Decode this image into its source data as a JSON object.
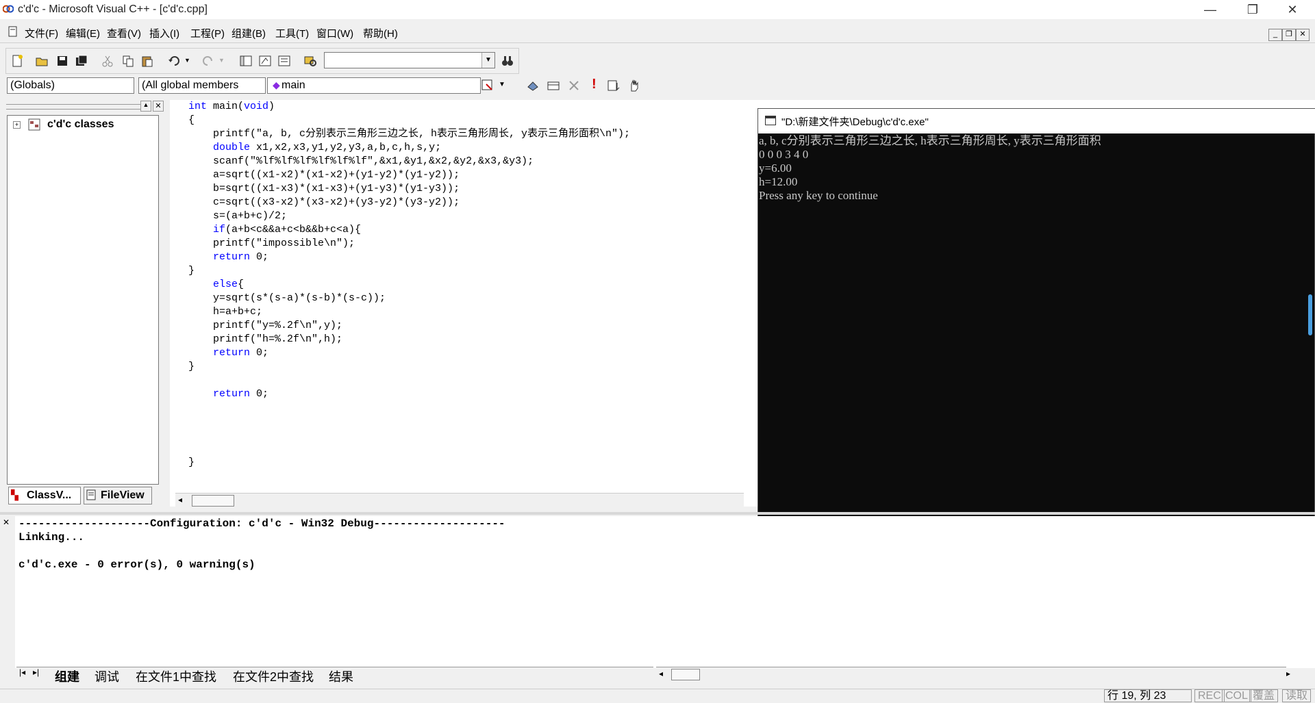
{
  "window": {
    "title": "c'd'c - Microsoft Visual C++ - [c'd'c.cpp]",
    "controls": [
      "—",
      "❐",
      "✕"
    ]
  },
  "menu": [
    "文件(F)",
    "编辑(E)",
    "查看(V)",
    "插入(I)",
    "工程(P)",
    "组建(B)",
    "工具(T)",
    "窗口(W)",
    "帮助(H)"
  ],
  "wizard_bar": {
    "scope": "(Globals)",
    "filter": "(All global members",
    "member": "main"
  },
  "workspace": {
    "tree_root": "c'd'c classes",
    "tabs": [
      "ClassV...",
      "FileView"
    ]
  },
  "editor": {
    "lines": [
      [
        {
          "t": "int",
          "k": true
        },
        {
          "t": " main("
        },
        {
          "t": "void",
          "k": true
        },
        {
          "t": ")"
        }
      ],
      [
        {
          "t": "{"
        }
      ],
      [
        {
          "t": "    printf(\"a, b, c分别表示三角形三边之长, h表示三角形周长, y表示三角形面积\\n\");"
        }
      ],
      [
        {
          "t": "    "
        },
        {
          "t": "double",
          "k": true
        },
        {
          "t": " x1,x2,x3,y1,y2,y3,a,b,c,h,s,y;"
        }
      ],
      [
        {
          "t": "    scanf(\"%lf%lf%lf%lf%lf%lf\",&x1,&y1,&x2,&y2,&x3,&y3);"
        }
      ],
      [
        {
          "t": "    a=sqrt((x1-x2)*(x1-x2)+(y1-y2)*(y1-y2));"
        }
      ],
      [
        {
          "t": "    b=sqrt((x1-x3)*(x1-x3)+(y1-y3)*(y1-y3));"
        }
      ],
      [
        {
          "t": "    c=sqrt((x3-x2)*(x3-x2)+(y3-y2)*(y3-y2));"
        }
      ],
      [
        {
          "t": "    s=(a+b+c)/2;"
        }
      ],
      [
        {
          "t": "    "
        },
        {
          "t": "if",
          "k": true
        },
        {
          "t": "(a+b<c&&a+c<b&&b+c<a){"
        }
      ],
      [
        {
          "t": "    printf(\"impossible\\n\");"
        }
      ],
      [
        {
          "t": "    "
        },
        {
          "t": "return",
          "k": true
        },
        {
          "t": " 0;"
        }
      ],
      [
        {
          "t": "}"
        }
      ],
      [
        {
          "t": "    "
        },
        {
          "t": "else",
          "k": true
        },
        {
          "t": "{"
        }
      ],
      [
        {
          "t": "    y=sqrt(s*(s-a)*(s-b)*(s-c));"
        }
      ],
      [
        {
          "t": "    h=a+b+c;"
        }
      ],
      [
        {
          "t": "    printf(\"y=%.2f\\n\",y);"
        }
      ],
      [
        {
          "t": "    printf(\"h=%.2f\\n\",h);"
        }
      ],
      [
        {
          "t": "    "
        },
        {
          "t": "return",
          "k": true
        },
        {
          "t": " 0;"
        }
      ],
      [
        {
          "t": "}"
        }
      ],
      [
        {
          "t": ""
        }
      ],
      [
        {
          "t": "    "
        },
        {
          "t": "return",
          "k": true
        },
        {
          "t": " 0;"
        }
      ],
      [
        {
          "t": ""
        }
      ],
      [
        {
          "t": ""
        }
      ],
      [
        {
          "t": ""
        }
      ],
      [
        {
          "t": ""
        }
      ],
      [
        {
          "t": "}"
        }
      ]
    ]
  },
  "console": {
    "title": "\"D:\\新建文件夹\\Debug\\c'd'c.exe\"",
    "lines": [
      "a, b, c分别表示三角形三边之长, h表示三角形周长, y表示三角形面积",
      "0 0 0 3 4 0",
      "y=6.00",
      "h=12.00",
      "Press any key to continue"
    ]
  },
  "output": {
    "lines": [
      "--------------------Configuration: c'd'c - Win32 Debug--------------------",
      "Linking...",
      "",
      "c'd'c.exe - 0 error(s), 0 warning(s)"
    ],
    "tabs": [
      "组建",
      "调试",
      "在文件1中查找",
      "在文件2中查找",
      "结果"
    ]
  },
  "status": {
    "position": "行 19, 列 23",
    "indicators": [
      "REC",
      "COL",
      "覆盖",
      "读取"
    ]
  }
}
